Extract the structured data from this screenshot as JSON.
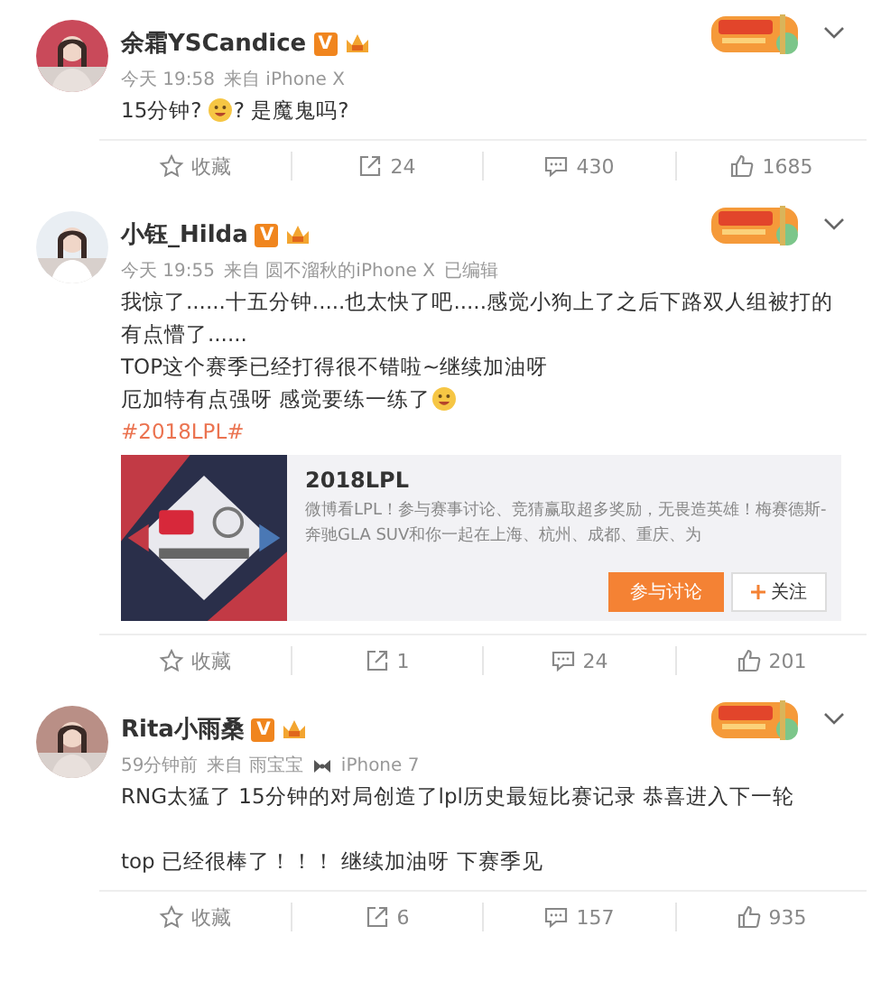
{
  "posts": [
    {
      "user": {
        "name": "余霜YSCandice",
        "verified_mark": "V"
      },
      "meta": [
        {
          "kind": "text",
          "text": "今天 19:58"
        },
        {
          "kind": "text",
          "text": "来自 iPhone X"
        }
      ],
      "body": [
        [
          {
            "kind": "text",
            "text": "15分钟? "
          },
          {
            "kind": "emoji"
          },
          {
            "kind": "text",
            "text": "? 是魔鬼吗?"
          }
        ]
      ],
      "actions": [
        {
          "kind": "favorite",
          "label": "收藏"
        },
        {
          "kind": "repost",
          "label": "24"
        },
        {
          "kind": "comment",
          "label": "430"
        },
        {
          "kind": "like",
          "label": "1685"
        }
      ]
    },
    {
      "user": {
        "name": "小钰_Hilda",
        "verified_mark": "V"
      },
      "meta": [
        {
          "kind": "text",
          "text": "今天 19:55"
        },
        {
          "kind": "text",
          "text": "来自 圆不溜秋的iPhone X"
        },
        {
          "kind": "text",
          "text": "已编辑"
        }
      ],
      "body": [
        [
          {
            "kind": "text",
            "text": "我惊了......十五分钟.....也太快了吧.....感觉小狗上了之后下路双人组被打的有点懵了......"
          }
        ],
        [
          {
            "kind": "text",
            "text": "TOP这个赛季已经打得很不错啦~继续加油呀"
          }
        ],
        [
          {
            "kind": "text",
            "text": "厄加特有点强呀 感觉要练一练了"
          },
          {
            "kind": "emoji"
          }
        ],
        [
          {
            "kind": "hashtag",
            "text": "#2018LPL#"
          }
        ]
      ],
      "card": {
        "title": "2018LPL",
        "description": "微博看LPL！参与赛事讨论、竞猜赢取超多奖励，无畏造英雄！梅赛德斯-奔驰GLA SUV和你一起在上海、杭州、成都、重庆、为",
        "primary_button": "参与讨论",
        "follow_button": "关注"
      },
      "actions": [
        {
          "kind": "favorite",
          "label": "收藏"
        },
        {
          "kind": "repost",
          "label": "1"
        },
        {
          "kind": "comment",
          "label": "24"
        },
        {
          "kind": "like",
          "label": "201"
        }
      ]
    },
    {
      "user": {
        "name": "Rita小雨桑",
        "verified_mark": "V"
      },
      "meta": [
        {
          "kind": "text",
          "text": "59分钟前"
        },
        {
          "kind": "text",
          "text": "来自 雨宝宝"
        },
        {
          "kind": "icon"
        },
        {
          "kind": "text",
          "text": "iPhone 7"
        }
      ],
      "body": [
        [
          {
            "kind": "text",
            "text": "RNG太猛了  15分钟的对局创造了lpl历史最短比赛记录 恭喜进入下一轮"
          }
        ],
        [
          {
            "kind": "blank"
          }
        ],
        [
          {
            "kind": "text",
            "text": "top 已经很棒了！！！  继续加油呀 下赛季见"
          }
        ]
      ],
      "actions": [
        {
          "kind": "favorite",
          "label": "收藏"
        },
        {
          "kind": "repost",
          "label": "6"
        },
        {
          "kind": "comment",
          "label": "157"
        },
        {
          "kind": "like",
          "label": "935"
        }
      ]
    }
  ]
}
